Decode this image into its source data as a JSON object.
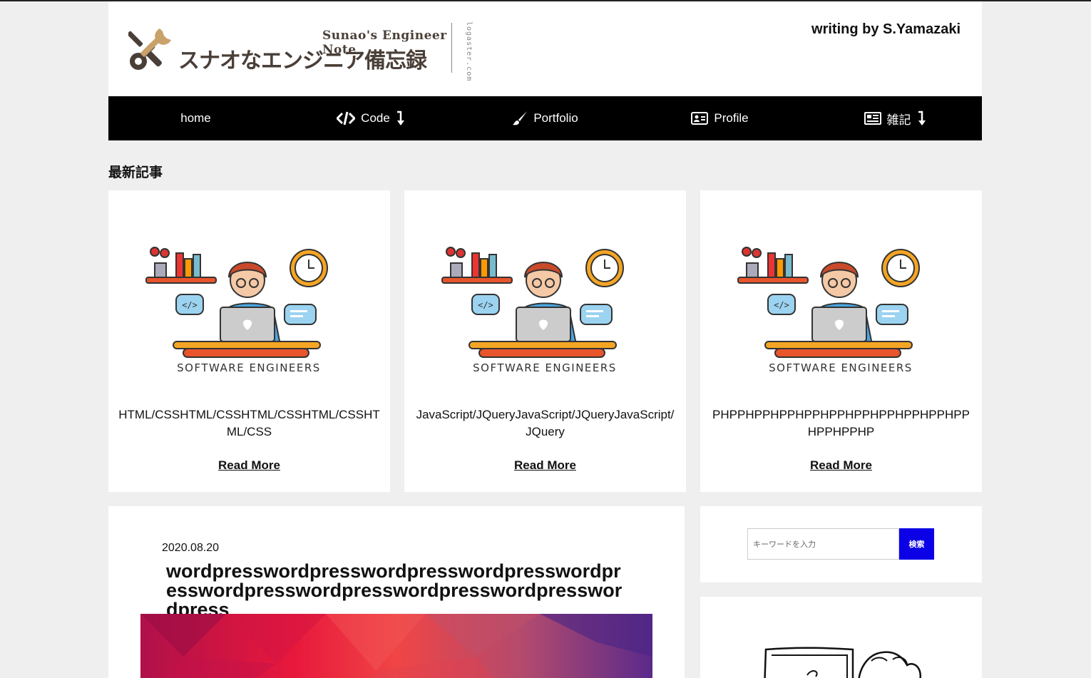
{
  "header": {
    "logo_en": "Sunao's Engineer Note",
    "logo_jp": "スナオなエンジニア備忘録",
    "logo_domain": "logaster.com",
    "author": "writing by S.Yamazaki"
  },
  "nav": {
    "items": [
      {
        "label": "home",
        "icon": "none"
      },
      {
        "label": "Code",
        "icon": "code-icon"
      },
      {
        "label": "Portfolio",
        "icon": "brush-icon"
      },
      {
        "label": "Profile",
        "icon": "id-card-icon"
      },
      {
        "label": "雑記",
        "icon": "newspaper-icon"
      }
    ]
  },
  "section_title": "最新記事",
  "cards": [
    {
      "image_caption": "SOFTWARE ENGINEERS",
      "title": "HTML/CSSHTML/CSSHTML/CSSHTML/CSSHTML/CSS",
      "more": "Read More"
    },
    {
      "image_caption": "SOFTWARE ENGINEERS",
      "title": "JavaScript/JQueryJavaScript/JQueryJavaScript/JQuery",
      "more": "Read More"
    },
    {
      "image_caption": "SOFTWARE ENGINEERS",
      "title": "PHPPHPPHPPHPPHPPHPPHPPHPPHPPHPPHPPHPPHP",
      "more": "Read More"
    }
  ],
  "article": {
    "date": "2020.08.20",
    "title": "wordpresswordpresswordpresswordpresswordpresswordpresswordpresswordpresswordpresswordpress"
  },
  "search": {
    "placeholder": "キーワードを入力",
    "button": "検索"
  },
  "colors": {
    "nav_bg": "#000000",
    "search_button": "#0b00e6",
    "page_bg": "#efefef"
  }
}
